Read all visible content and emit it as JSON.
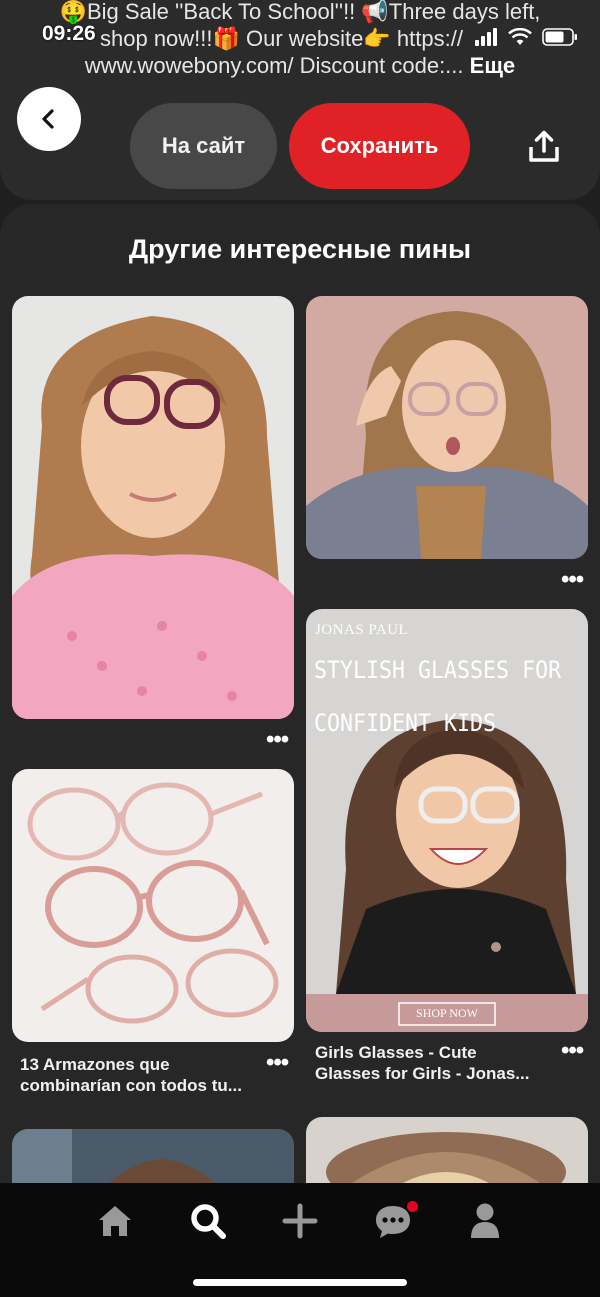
{
  "status_bar": {
    "time": "09:26"
  },
  "pin_description": {
    "line1": "🤑Big Sale ''Back To School''!! 📢Three days left,",
    "line1b": "shop now!!!🎁 Our website👉 https://",
    "line2": "www.wowebony.com/ Discount code:...",
    "more_label": "Еще"
  },
  "header": {
    "visit_site_label": "На сайт",
    "save_label": "Сохранить"
  },
  "feed": {
    "title": "Другие интересные пины",
    "pins": [
      {
        "caption": ""
      },
      {
        "caption": ""
      },
      {
        "caption_line1": "13 Armazones que",
        "caption_line2": "combinarían con todos tu..."
      },
      {
        "overlay_brand": "JONAS PAUL",
        "overlay_heading_1": "STYLISH GLASSES FOR",
        "overlay_heading_2": "CONFIDENT KIDS",
        "overlay_button": "SHOP NOW",
        "caption_line1": "Girls Glasses - Cute",
        "caption_line2": "Glasses for Girls - Jonas..."
      }
    ],
    "more_icon": "•••"
  },
  "tabbar": {
    "tabs": [
      "home-icon",
      "search-icon",
      "plus-icon",
      "messages-icon",
      "profile-icon"
    ],
    "notification_color": "#e60023"
  },
  "colors": {
    "accent": "#e02227"
  }
}
